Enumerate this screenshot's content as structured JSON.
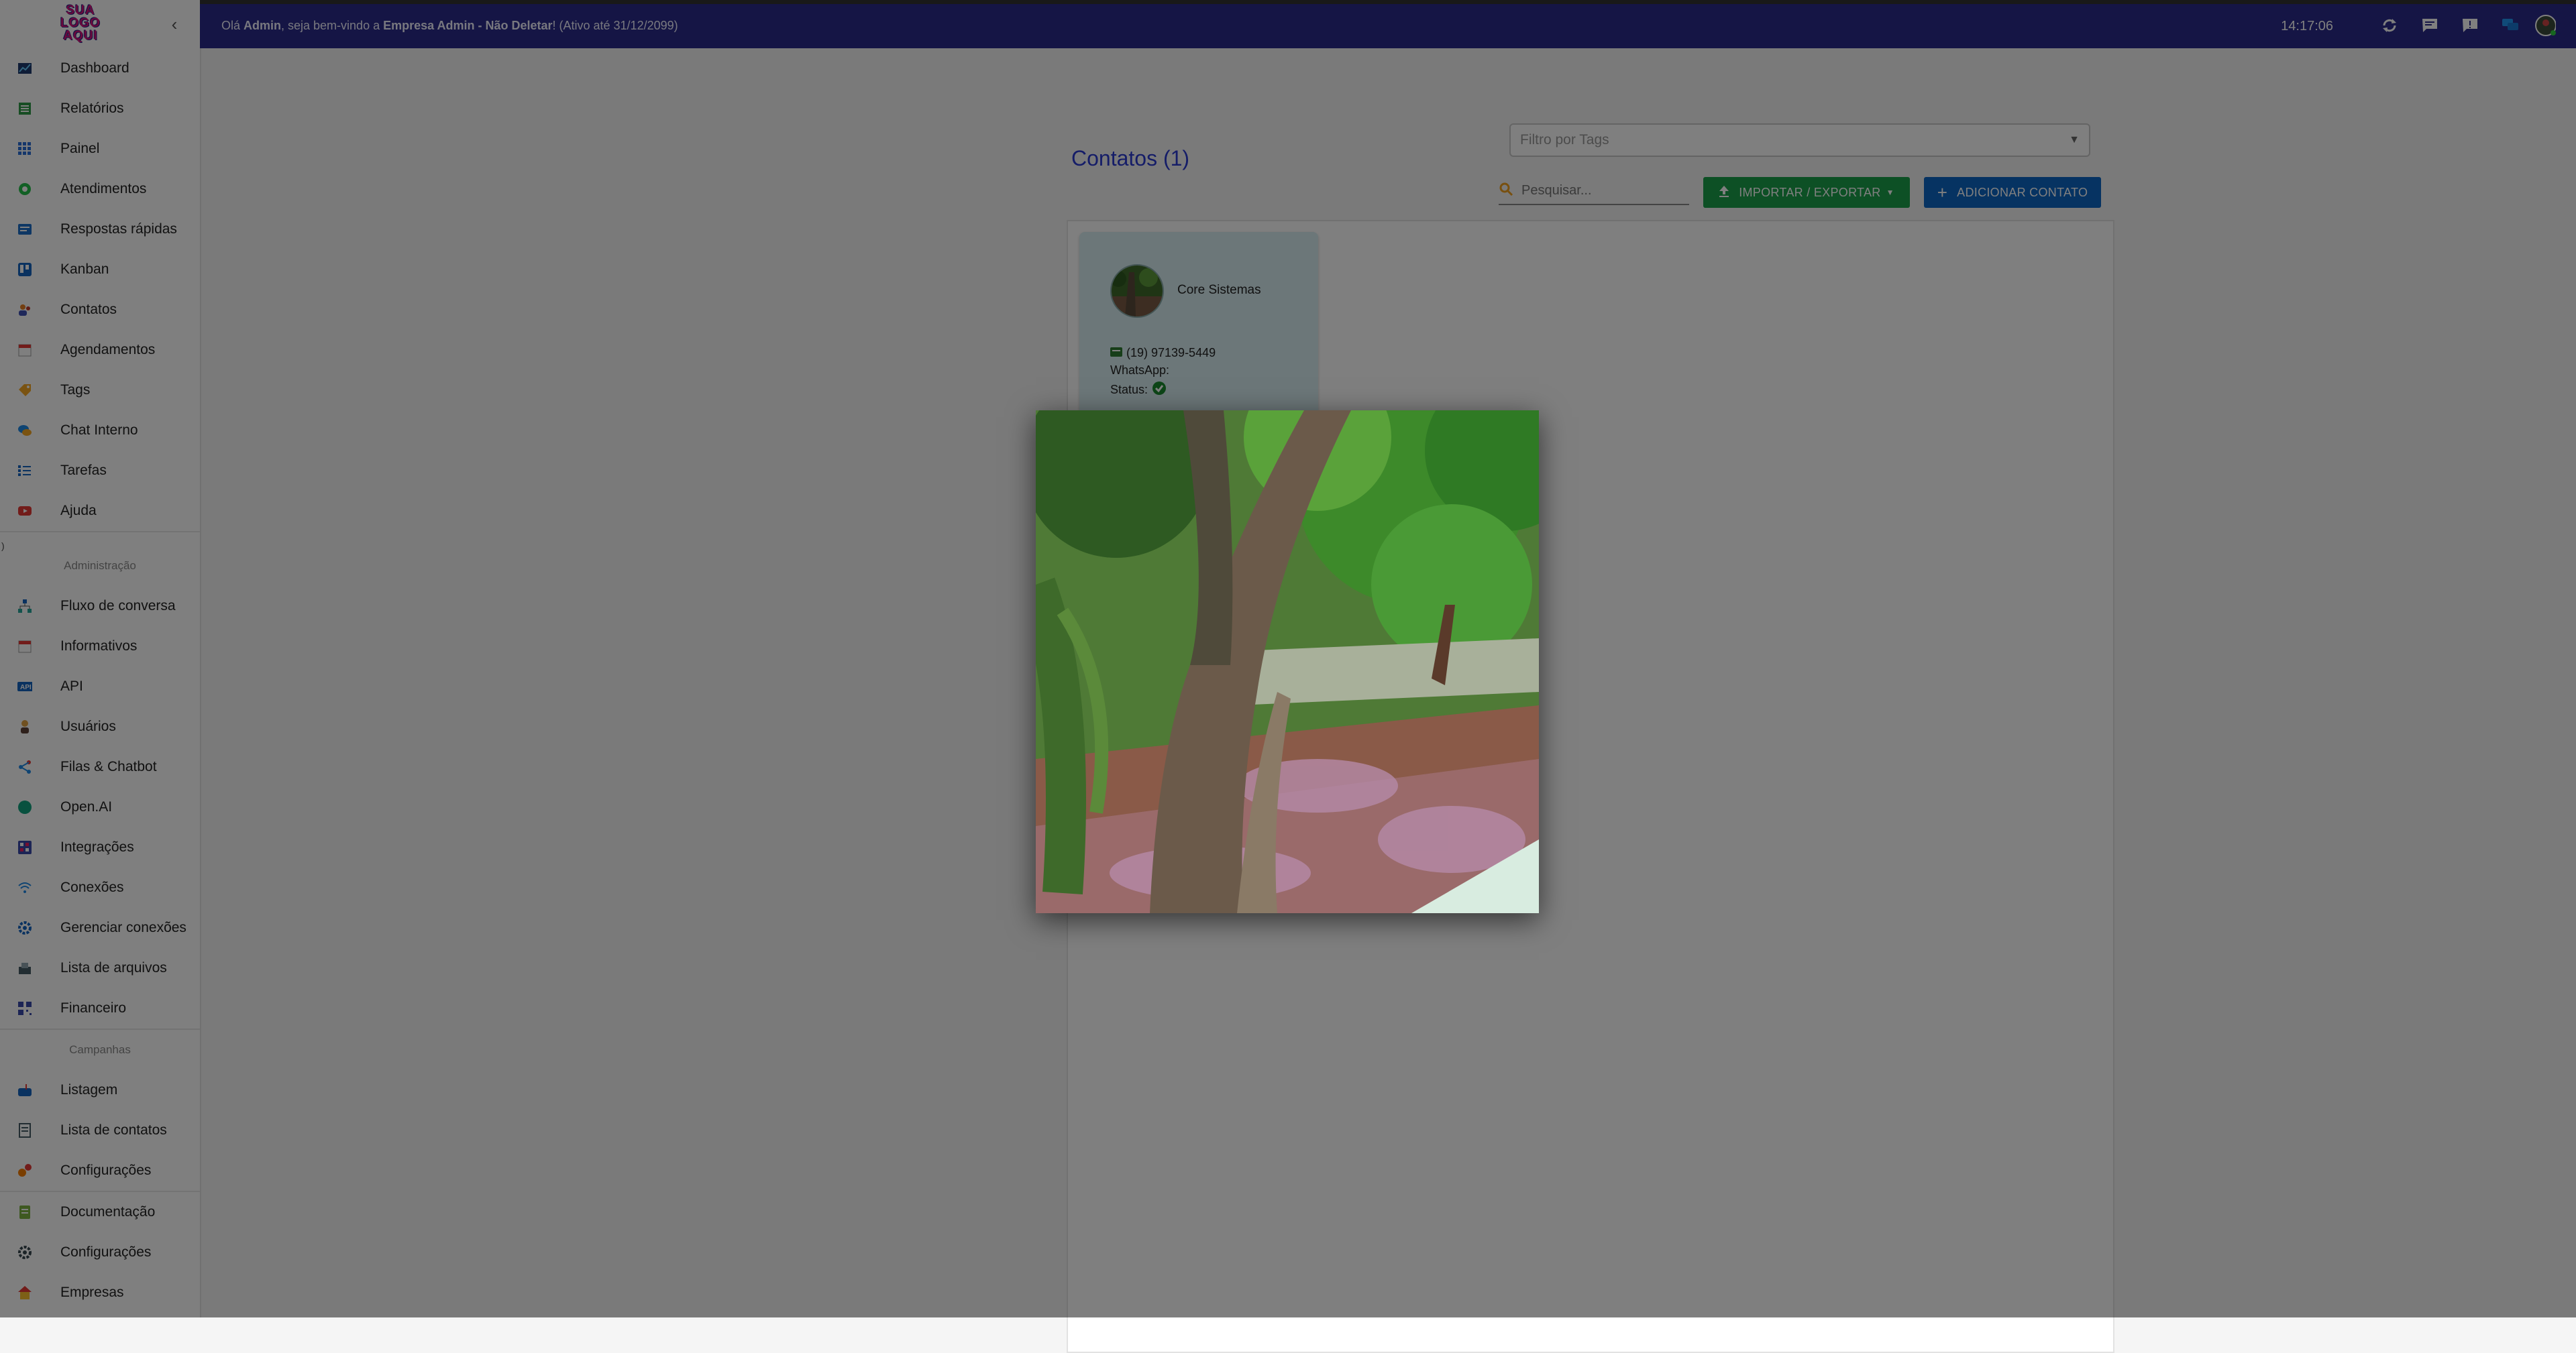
{
  "sidebar": {
    "logo_text": "SUA LOGO AQUI",
    "collapse_icon": "chevron-left-icon",
    "items": [
      {
        "label": "Dashboard",
        "icon": "dashboard-icon"
      },
      {
        "label": "Relatórios",
        "icon": "report-icon"
      },
      {
        "label": "Painel",
        "icon": "grid-icon"
      },
      {
        "label": "Atendimentos",
        "icon": "whatsapp-icon"
      },
      {
        "label": "Respostas rápidas",
        "icon": "quick-reply-icon"
      },
      {
        "label": "Kanban",
        "icon": "kanban-icon"
      },
      {
        "label": "Contatos",
        "icon": "contacts-icon"
      },
      {
        "label": "Agendamentos",
        "icon": "calendar-icon"
      },
      {
        "label": "Tags",
        "icon": "tag-icon"
      },
      {
        "label": "Chat Interno",
        "icon": "chat-icon"
      },
      {
        "label": "Tarefas",
        "icon": "tasks-icon"
      },
      {
        "label": "Ajuda",
        "icon": "youtube-icon"
      }
    ],
    "admin_section": "Administração",
    "admin_items": [
      {
        "label": "Fluxo de conversa",
        "icon": "flow-icon"
      },
      {
        "label": "Informativos",
        "icon": "calendar-icon"
      },
      {
        "label": "API",
        "icon": "api-icon"
      },
      {
        "label": "Usuários",
        "icon": "user-icon"
      },
      {
        "label": "Filas & Chatbot",
        "icon": "share-icon"
      },
      {
        "label": "Open.AI",
        "icon": "openai-icon"
      },
      {
        "label": "Integrações",
        "icon": "integrations-icon"
      },
      {
        "label": "Conexões",
        "icon": "wifi-icon"
      },
      {
        "label": "Gerenciar conexões",
        "icon": "gear-icon"
      },
      {
        "label": "Lista de arquivos",
        "icon": "file-list-icon"
      },
      {
        "label": "Financeiro",
        "icon": "qr-icon"
      }
    ],
    "campaign_section": "Campanhas",
    "campaign_items": [
      {
        "label": "Listagem",
        "icon": "mailbox-icon"
      },
      {
        "label": "Lista de contatos",
        "icon": "contact-list-icon"
      },
      {
        "label": "Configurações",
        "icon": "gears-icon"
      }
    ],
    "bottom_items": [
      {
        "label": "Documentação",
        "icon": "document-icon"
      },
      {
        "label": "Configurações",
        "icon": "settings-icon"
      },
      {
        "label": "Empresas",
        "icon": "building-icon"
      }
    ],
    "stray_glyph": ")"
  },
  "header": {
    "greeting_prefix": "Olá ",
    "user": "Admin",
    "greeting_mid": ", seja bem-vindo a ",
    "company": "Empresa Admin - Não Deletar",
    "greeting_suffix": "! (Ativo até 31/12/2099)",
    "time": "14:17:06",
    "icons": [
      "refresh-icon",
      "chat-bubble-icon",
      "feedback-icon",
      "messages-icon",
      "user-avatar-icon"
    ]
  },
  "main": {
    "title": "Contatos (1)",
    "tag_filter_placeholder": "Filtro por Tags",
    "search_placeholder": "Pesquisar...",
    "import_export_label": "IMPORTAR / EXPORTAR",
    "add_contact_label": "ADICIONAR CONTATO"
  },
  "contact": {
    "name": "Core Sistemas",
    "phone": "(19) 97139-5449",
    "whatsapp_label": "WhatsApp:",
    "status_label": "Status:",
    "actions": [
      "whatsapp-icon",
      "edit-icon",
      "block-icon",
      "delete-icon"
    ]
  },
  "colors": {
    "appbar": "#2a2a8a",
    "title": "#2b3bd0",
    "import_button": "#1aa04a",
    "add_button": "#0d66c4",
    "card": "#d9eef2"
  }
}
